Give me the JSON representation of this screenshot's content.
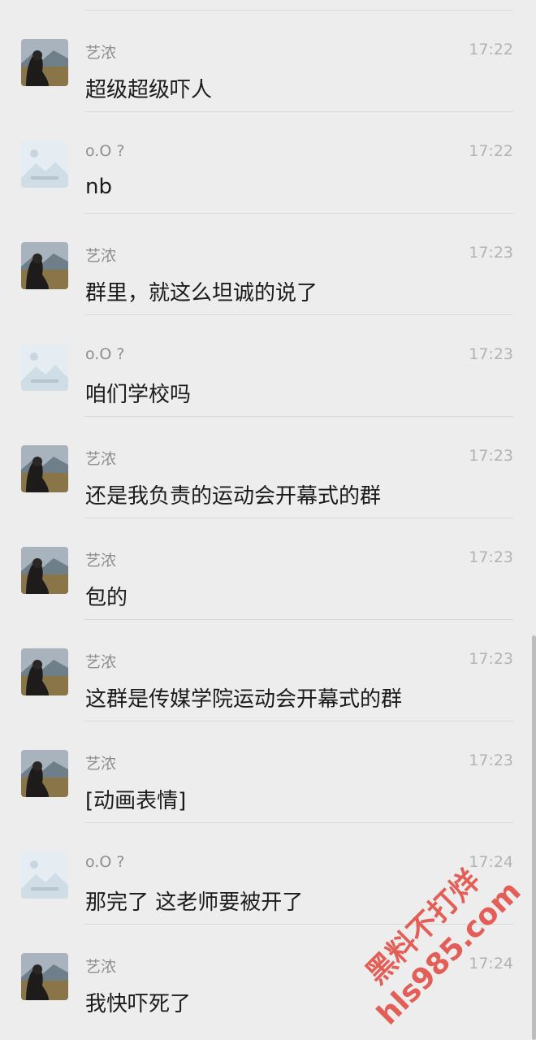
{
  "messages": [
    {
      "sender": "艺浓",
      "time": "17:22",
      "text": "超级超级吓人",
      "avatar": "photo-avatar"
    },
    {
      "sender": "o.O ?",
      "time": "17:22",
      "text": "nb",
      "avatar": "placeholder-avatar"
    },
    {
      "sender": "艺浓",
      "time": "17:23",
      "text": "群里，就这么坦诚的说了",
      "avatar": "photo-avatar"
    },
    {
      "sender": "o.O ?",
      "time": "17:23",
      "text": "咱们学校吗",
      "avatar": "placeholder-avatar"
    },
    {
      "sender": "艺浓",
      "time": "17:23",
      "text": "还是我负责的运动会开幕式的群",
      "avatar": "photo-avatar"
    },
    {
      "sender": "艺浓",
      "time": "17:23",
      "text": "包的",
      "avatar": "photo-avatar"
    },
    {
      "sender": "艺浓",
      "time": "17:23",
      "text": "这群是传媒学院运动会开幕式的群",
      "avatar": "photo-avatar"
    },
    {
      "sender": "艺浓",
      "time": "17:23",
      "text": "[动画表情]",
      "avatar": "photo-avatar"
    },
    {
      "sender": "o.O ?",
      "time": "17:24",
      "text": "那完了 这老师要被开了",
      "avatar": "placeholder-avatar"
    },
    {
      "sender": "艺浓",
      "time": "17:24",
      "text": "我快吓死了",
      "avatar": "photo-avatar"
    }
  ],
  "watermark": {
    "line1": "黑料不打烊",
    "line2": "hls985.com",
    "color": "#e0443b"
  },
  "colors": {
    "background": "#ededed",
    "text": "#1b1b1b",
    "meta": "#8f8f8f"
  }
}
